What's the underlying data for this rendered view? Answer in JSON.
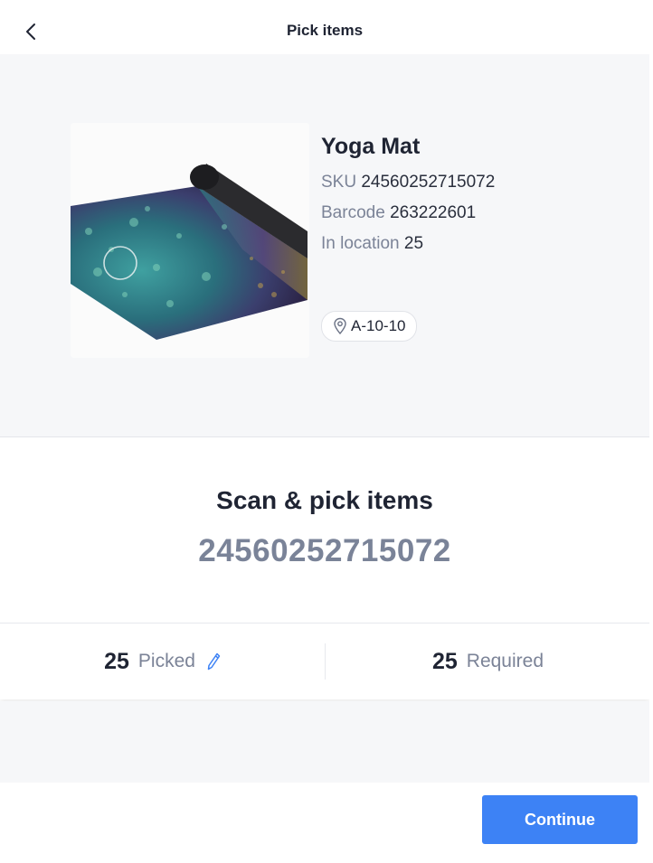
{
  "header": {
    "title": "Pick items",
    "back_icon": "chevron-left-icon"
  },
  "product": {
    "name": "Yoga Mat",
    "sku_label": "SKU",
    "sku": "24560252715072",
    "barcode_label": "Barcode",
    "barcode": "263222601",
    "in_location_label": "In location",
    "in_location": "25",
    "location_icon": "map-pin-icon",
    "location": "A-10-10",
    "image": "yoga-mat-product-image"
  },
  "scan": {
    "heading": "Scan & pick items",
    "code": "24560252715072"
  },
  "counts": {
    "picked_value": "25",
    "picked_label": "Picked",
    "edit_icon": "pencil-icon",
    "required_value": "25",
    "required_label": "Required"
  },
  "footer": {
    "continue_label": "Continue"
  },
  "colors": {
    "accent": "#3d82f5",
    "muted_text": "#7b8397",
    "primary_text": "#1f2433",
    "panel_background": "#f6f7f9"
  }
}
